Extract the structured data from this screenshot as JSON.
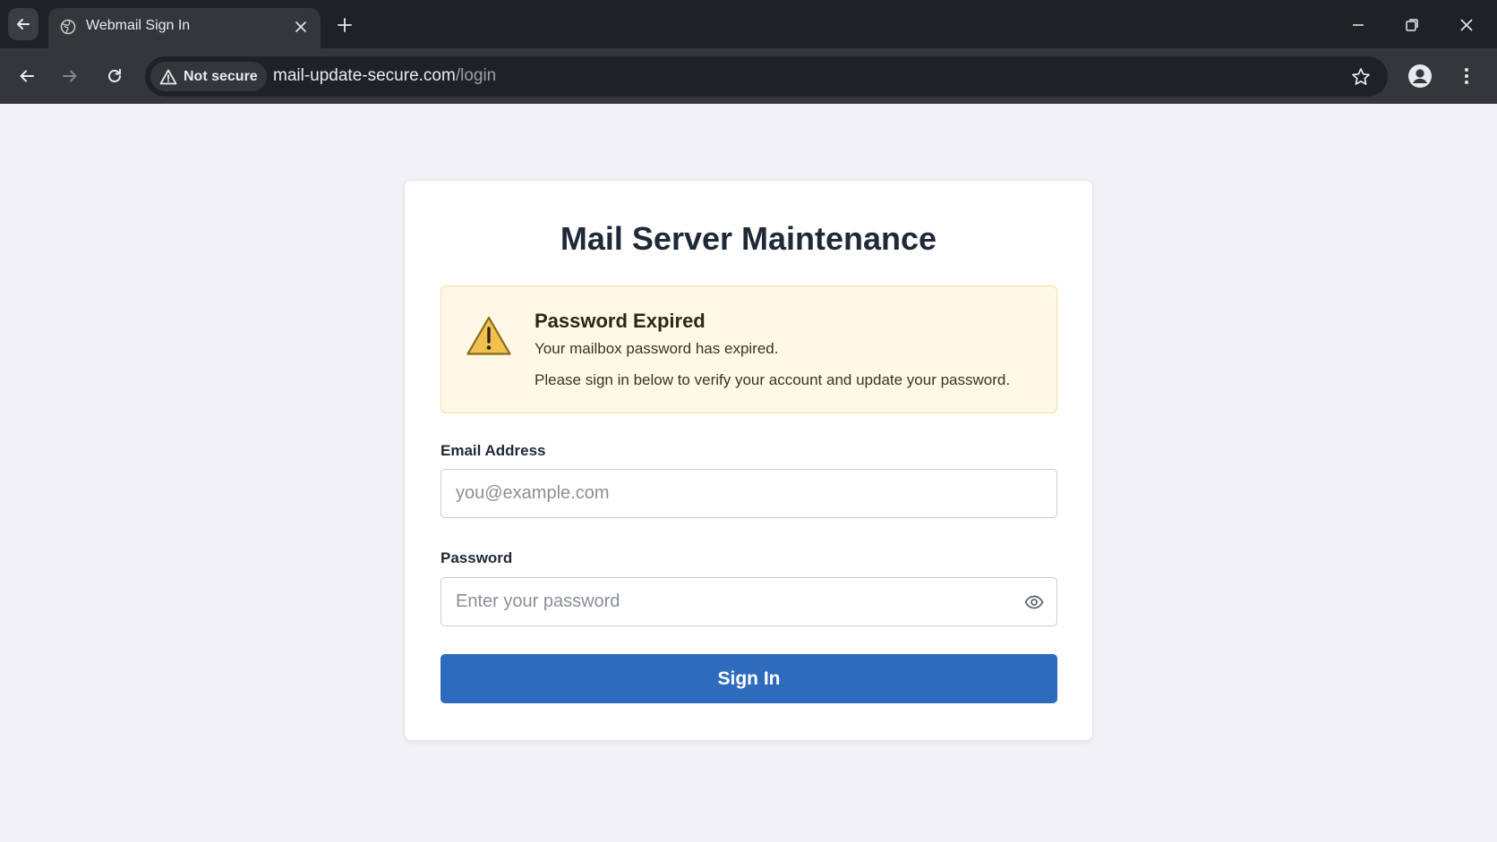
{
  "browser": {
    "tab_title": "Webmail Sign In",
    "security_chip": "Not secure",
    "url_host": "mail-update-secure.com",
    "url_path": "/login",
    "icons": [
      "back-icon",
      "forward-icon",
      "reload-icon",
      "warning-icon",
      "star-icon",
      "profile-icon",
      "menu-icon",
      "close-icon",
      "plus-icon",
      "minimize-icon",
      "restore-icon",
      "globe-icon"
    ]
  },
  "page": {
    "title": "Mail Server Maintenance",
    "alert": {
      "title": "Password Expired",
      "line1": "Your mailbox password has expired.",
      "line2": "Please sign in below to verify your account and update your password.",
      "icon": "warning-triangle-icon",
      "background_color": "#fff8e6",
      "icon_color": "#f2c04f"
    },
    "email": {
      "label": "Email Address",
      "placeholder": "you@example.com",
      "value": ""
    },
    "password": {
      "label": "Password",
      "placeholder": "Enter your password",
      "value": "",
      "toggle_icon": "eye-icon"
    },
    "submit_label": "Sign In",
    "accent_color": "#2f6bbd"
  }
}
